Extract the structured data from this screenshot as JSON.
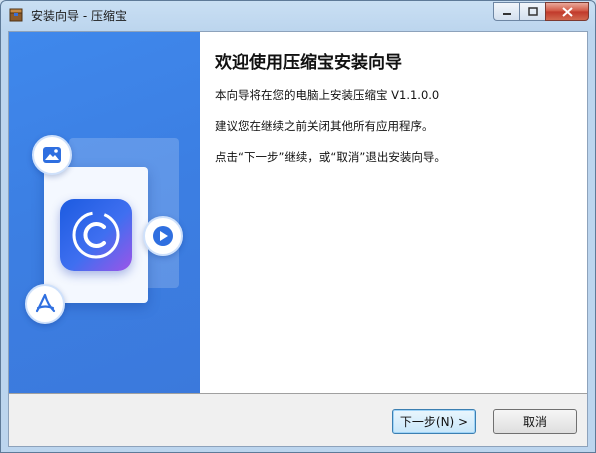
{
  "window": {
    "title": "安装向导 - 压缩宝",
    "title_icon": "installer-box-icon",
    "caption": {
      "minimize_icon": "minimize-icon",
      "maximize_icon": "maximize-icon",
      "close_icon": "close-icon"
    }
  },
  "content": {
    "heading": "欢迎使用压缩宝安装向导",
    "line1": "本向导将在您的电脑上安装压缩宝 V1.1.0.0",
    "line2": "建议您在继续之前关闭其他所有应用程序。",
    "line3": "点击“下一步”继续，或“取消”退出安装向导。"
  },
  "buttons": {
    "next": "下一步(N) >",
    "cancel": "取消"
  },
  "sidebar": {
    "icons": [
      "image-icon",
      "play-icon",
      "pdf-icon",
      "app-logo-icon"
    ]
  },
  "colors": {
    "sidebar": "#3c80e4",
    "accent": "#3c7fb1"
  }
}
